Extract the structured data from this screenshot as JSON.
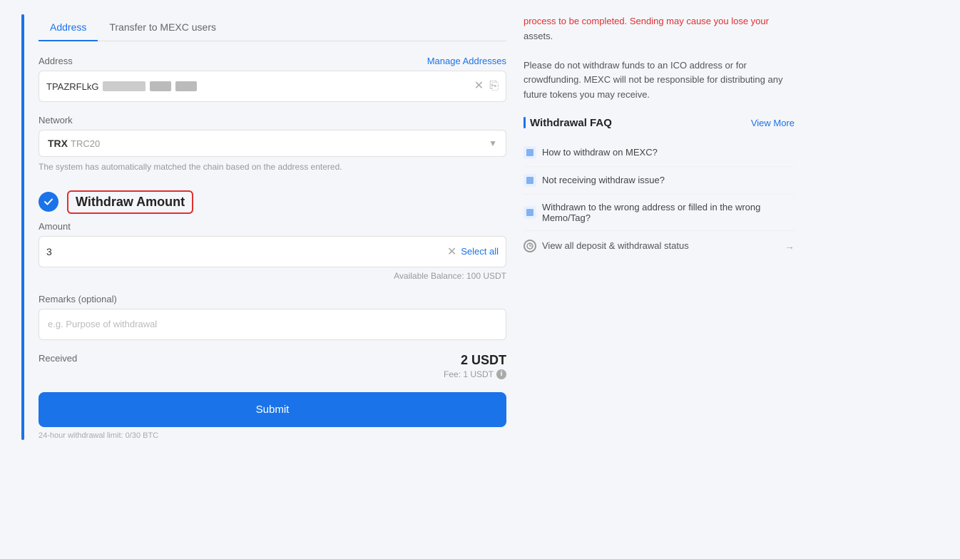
{
  "tabs": {
    "address_label": "Address",
    "transfer_label": "Transfer to MEXC users"
  },
  "address_section": {
    "label": "Address",
    "manage_link": "Manage Addresses",
    "value_prefix": "TPAZRFLkG",
    "clear_title": "Clear",
    "copy_title": "Copy"
  },
  "network_section": {
    "label": "Network",
    "network_name": "TRX",
    "network_sub": "TRC20",
    "hint": "The system has automatically matched the chain based on the address entered."
  },
  "step2": {
    "title": "Withdraw Amount"
  },
  "amount_section": {
    "label": "Amount",
    "value": "3",
    "select_all": "Select all",
    "available_balance": "Available Balance: 100 USDT"
  },
  "remarks_section": {
    "label": "Remarks (optional)",
    "placeholder": "e.g. Purpose of withdrawal"
  },
  "received_section": {
    "label": "Received",
    "amount": "2 USDT",
    "fee_label": "Fee: 1 USDT"
  },
  "submit_button": "Submit",
  "limit_text": "24-hour withdrawal limit: 0/30 BTC",
  "right_panel": {
    "warning_text_1": "process to be completed. Sending may cause you lose your assets.",
    "warning_text_2": "Please do not withdraw funds to an ICO address or for crowdfunding. MEXC will not be responsible for distributing any future tokens you may receive.",
    "faq_title": "Withdrawal FAQ",
    "view_more": "View More",
    "faq_items": [
      {
        "text": "How to withdraw on MEXC?"
      },
      {
        "text": "Not receiving withdraw issue?"
      },
      {
        "text": "Withdrawn to the wrong address or filled in the wrong Memo/Tag?"
      }
    ],
    "status_link": "View all deposit & withdrawal status"
  }
}
